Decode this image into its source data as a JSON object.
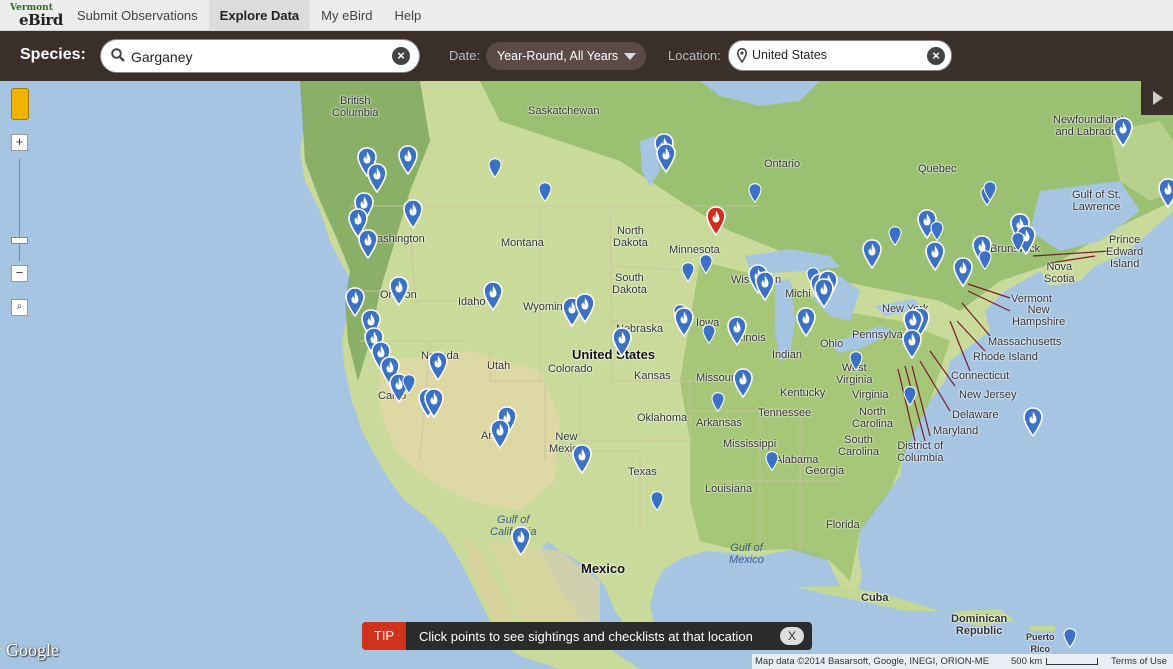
{
  "app": {
    "logo_top": "Vermont",
    "logo_bottom": "eBird"
  },
  "nav": {
    "items": [
      {
        "label": "Submit Observations",
        "active": false
      },
      {
        "label": "Explore Data",
        "active": true
      },
      {
        "label": "My eBird",
        "active": false
      },
      {
        "label": "Help",
        "active": false
      }
    ]
  },
  "search": {
    "species_label": "Species:",
    "species_value": "Garganey",
    "date_label": "Date:",
    "date_value": "Year-Round, All Years",
    "location_label": "Location:",
    "location_value": "United States"
  },
  "map": {
    "labels": {
      "bc": "British\nColumbia",
      "sask": "Saskatchewan",
      "ontario": "Ontario",
      "quebec": "Quebec",
      "nfl": "Newfoundland\nand Labrador",
      "gsl": "Gulf of St.\nLawrence",
      "pei": "Prince\nEdward\nIsland",
      "ns": "Nova\nScotia",
      "nb": "Brunswick",
      "wa": "Washington",
      "mt": "Montana",
      "nd": "North\nDakota",
      "mn": "Minnesota",
      "sd": "South\nDakota",
      "wi": "Wisconsin",
      "mi": "Michi",
      "or": "Oregon",
      "id": "Idaho",
      "wy": "Wyoming",
      "ne": "Nebraska",
      "ia": "Iowa",
      "il": "Illinois",
      "in": "Indian",
      "oh": "Ohio",
      "pa": "Pennsylvania",
      "ny": "New York",
      "vt": "Vermont",
      "nh": "New\nHampshire",
      "ma": "Massachusetts",
      "ri": "Rhode Island",
      "ct": "Connecticut",
      "nj": "New Jersey",
      "de": "Delaware",
      "md": "Maryland",
      "dc": "District of\nColumbia",
      "nv": "Nevada",
      "ut": "Utah",
      "co": "Colorado",
      "us": "United States",
      "ks": "Kansas",
      "mo": "Missouri",
      "ky": "Kentucky",
      "wv": "West\nVirginia",
      "va": "Virginia",
      "nc": "North\nCarolina",
      "tn": "Tennessee",
      "sc": "South\nCarolina",
      "ok": "Oklahoma",
      "ar": "Arkansas",
      "ms": "Mississippi",
      "al": "Alabama",
      "ga": "Georgia",
      "ca": "Califo",
      "az": "Ari",
      "nm": "New\nMexico",
      "tx": "Texas",
      "la": "Louisiana",
      "fl": "Florida",
      "gulf_cal": "Gulf of\nCalifornia",
      "gulf_mex": "Gulf of\nMexico",
      "mexico": "Mexico",
      "cuba": "Cuba",
      "dr": "Dominican\nRepublic",
      "pr": "Puerto\nRico"
    },
    "markers_count_note": "",
    "selected_marker_color": "#d42d1a",
    "marker_color": "#3b72c8"
  },
  "tip": {
    "tag": "TIP",
    "message": "Click points to see sightings and checklists at that location",
    "close": "X"
  },
  "footer": {
    "google": "Google",
    "map_data": "Map data ©2014 Basarsoft, Google, INEGI, ORION-ME",
    "scale": "500 km",
    "terms": "Terms of Use"
  }
}
